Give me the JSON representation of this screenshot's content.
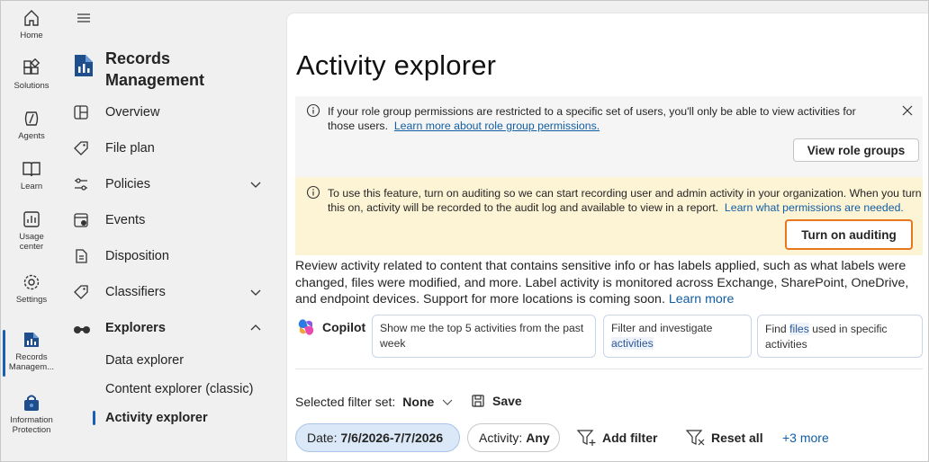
{
  "rail": {
    "items": [
      {
        "label": "Home",
        "icon": "home-icon"
      },
      {
        "label": "Solutions",
        "icon": "solutions-icon"
      },
      {
        "label": "Agents",
        "icon": "agents-icon"
      },
      {
        "label": "Learn",
        "icon": "learn-icon"
      },
      {
        "label": "Usage",
        "label2": "center",
        "icon": "usage-center-icon"
      },
      {
        "label": "Settings",
        "icon": "settings-icon"
      },
      {
        "label": "Records",
        "label2": "Managem...",
        "icon": "records-management-icon"
      },
      {
        "label": "Information",
        "label2": "Protection",
        "icon": "information-protection-icon"
      }
    ]
  },
  "nav": {
    "app_title": "Records Management",
    "items": [
      {
        "label": "Overview"
      },
      {
        "label": "File plan"
      },
      {
        "label": "Policies"
      },
      {
        "label": "Events"
      },
      {
        "label": "Disposition"
      },
      {
        "label": "Classifiers"
      },
      {
        "label": "Explorers"
      }
    ],
    "sub_items": [
      {
        "label": "Data explorer"
      },
      {
        "label": "Content explorer (classic)"
      },
      {
        "label": "Activity explorer"
      }
    ]
  },
  "main": {
    "title": "Activity explorer",
    "info": {
      "text": "If your role group permissions are restricted to a specific set of users, you'll only be able to view activities for those users.",
      "link": "Learn more about role group permissions.",
      "button": "View role groups"
    },
    "warning": {
      "text": "To use this feature, turn on auditing so we can start recording user and admin activity in your organization. When you turn this on, activity will be recorded to the audit log and available to view in a report.",
      "link": "Learn what permissions are needed.",
      "button": "Turn on auditing"
    },
    "description": "Review activity related to content that contains sensitive info or has labels applied, such as what labels were changed, files were modified, and more. Label activity is monitored across Exchange, SharePoint, OneDrive, and endpoint devices. Support for more locations is coming soon.",
    "description_link": "Learn more",
    "copilot": {
      "label": "Copilot",
      "prompts": [
        {
          "text": "Show me the top 5 activities from the past week"
        },
        {
          "pre": "Filter and investigate",
          "hl": "activities"
        },
        {
          "pre": "Find",
          "hl": "files",
          "post": "used in specific activities"
        }
      ]
    },
    "filters": {
      "set_label": "Selected filter set:",
      "set_value": "None",
      "save": "Save",
      "date_label": "Date:",
      "date_value": "7/6/2026-7/7/2026",
      "activity_label": "Activity:",
      "activity_value": "Any",
      "add_filter": "Add filter",
      "reset_all": "Reset all",
      "more": "+3 more"
    }
  },
  "colors": {
    "accent": "#1a5fb4",
    "link": "#115ea3",
    "warning_bg": "#fdf3d5",
    "highlight_border": "#e8761c"
  }
}
